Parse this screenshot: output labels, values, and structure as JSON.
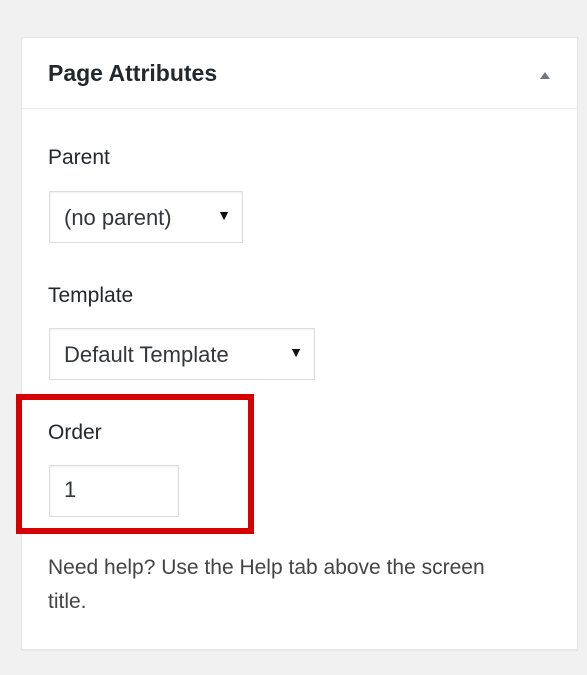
{
  "panel": {
    "title": "Page Attributes",
    "toggle_icon": "triangle-up-icon"
  },
  "parent": {
    "label": "Parent",
    "selected": "(no parent)",
    "caret_icon": "▼"
  },
  "template": {
    "label": "Template",
    "selected": "Default Template",
    "caret_icon": "▼"
  },
  "order": {
    "label": "Order",
    "value": "1"
  },
  "help": {
    "text": "Need help? Use the Help tab above the screen title."
  },
  "colors": {
    "highlight": "#d60000",
    "background": "#f1f1f1",
    "panel": "#ffffff"
  }
}
